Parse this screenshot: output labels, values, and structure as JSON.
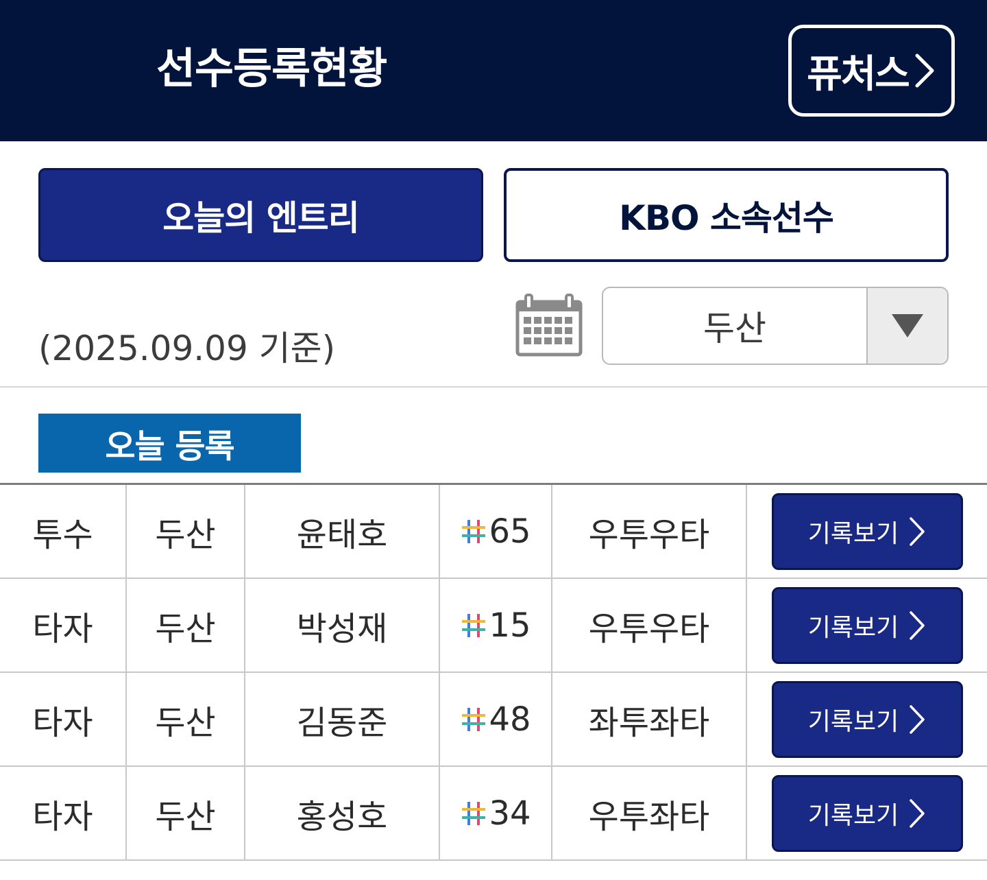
{
  "header": {
    "title": "선수등록현황",
    "future_label": "퓨처스"
  },
  "tabs": [
    {
      "label": "오늘의 엔트리",
      "active": true
    },
    {
      "label": "KBO 소속선수",
      "active": false
    }
  ],
  "date_text": "(2025.09.09 기준)",
  "team_select": {
    "value": "두산"
  },
  "section_label": "오늘 등록",
  "colors": {
    "header_bg": "#02133c",
    "accent": "#182a86",
    "badge": "#0a66ac"
  },
  "rows": [
    {
      "position": "투수",
      "team": "두산",
      "name": "윤태호",
      "number": "65",
      "hand": "우투우타",
      "action": "기록보기"
    },
    {
      "position": "타자",
      "team": "두산",
      "name": "박성재",
      "number": "15",
      "hand": "우투우타",
      "action": "기록보기"
    },
    {
      "position": "타자",
      "team": "두산",
      "name": "김동준",
      "number": "48",
      "hand": "좌투좌타",
      "action": "기록보기"
    },
    {
      "position": "타자",
      "team": "두산",
      "name": "홍성호",
      "number": "34",
      "hand": "우투좌타",
      "action": "기록보기"
    }
  ]
}
